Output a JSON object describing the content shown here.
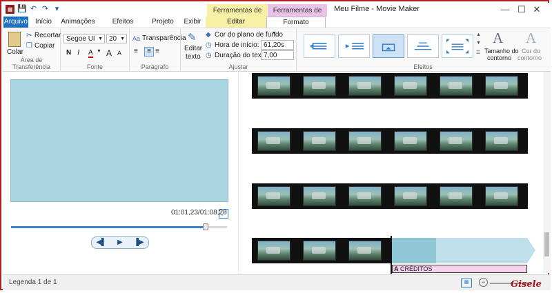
{
  "window": {
    "title": "Meu Filme - Movie Maker",
    "contexts": {
      "video": "Ferramentas de Vídeo",
      "text": "Ferramentas de Texto"
    },
    "controls": {
      "minimize": "—",
      "maximize": "☐",
      "close": "✕"
    }
  },
  "qat": {
    "save": "💾",
    "undo": "↶",
    "redo": "↷",
    "more": "▾"
  },
  "tabs": {
    "file": "Arquivo",
    "home": "Início",
    "animations": "Animações",
    "effects": "Efeitos Visuais",
    "project": "Projeto",
    "view": "Exibir",
    "edit": "Editar",
    "format": "Formato"
  },
  "ribbon": {
    "clipboard": {
      "paste": "Colar",
      "cut": "Recortar",
      "copy": "Copiar",
      "label": "Área de Transferência"
    },
    "font": {
      "family": "Segoe UI",
      "size": "20",
      "bold": "N",
      "italic": "I",
      "color": "A",
      "grow": "A",
      "shrink": "A",
      "label": "Fonte"
    },
    "paragraph": {
      "transparency": "Transparência",
      "label": "Parágrafo"
    },
    "adjust": {
      "edit_text": "Editar",
      "edit_text2": "texto",
      "bg_color": "Cor do plano de fundo",
      "start_label": "Hora de início:",
      "start_value": "61,20s",
      "duration_label": "Duração do texto:",
      "duration_value": "7,00",
      "label": "Ajustar"
    },
    "effects": {
      "label": "Efeitos",
      "outline_size": "Tamanho do",
      "outline_size2": "contorno",
      "outline_color": "Cor do",
      "outline_color2": "contorno"
    }
  },
  "preview": {
    "time": "01:01,23/01:08,20",
    "progress_percent": 90
  },
  "player": {
    "prev": "◀▌",
    "play": "▶",
    "next": "▐▶"
  },
  "storyboard": {
    "caption_label": "CRÉDITOS"
  },
  "status": {
    "text": "Legenda 1 de 1"
  },
  "signature": "Gisele",
  "colors": {
    "accent": "#1e6fc2",
    "preview": "#a9d5e1",
    "caption": "#f5d3ea",
    "video_ctx": "#f7f0a6",
    "text_ctx": "#e9c3e6"
  }
}
